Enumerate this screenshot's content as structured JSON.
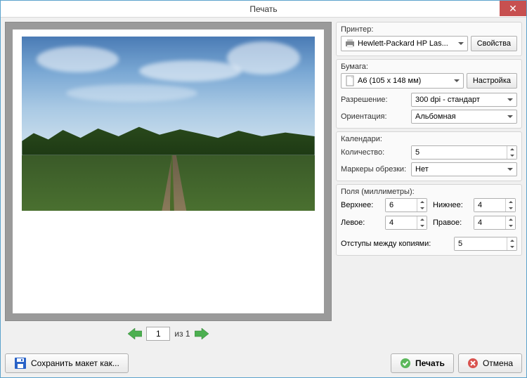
{
  "window_title": "Печать",
  "printer": {
    "section_label": "Принтер:",
    "selected": "Hewlett-Packard HP Las...",
    "props_btn": "Свойства"
  },
  "paper": {
    "section_label": "Бумага:",
    "selected": "A6 (105 x 148 мм)",
    "setup_btn": "Настройка",
    "resolution_label": "Разрешение:",
    "resolution_value": "300 dpi - стандарт",
    "orientation_label": "Ориентация:",
    "orientation_value": "Альбомная"
  },
  "calendars": {
    "section_label": "Календари:",
    "count_label": "Количество:",
    "count_value": "5",
    "crop_label": "Маркеры обрезки:",
    "crop_value": "Нет"
  },
  "margins": {
    "section_label": "Поля (миллиметры):",
    "top_label": "Верхнее:",
    "top_value": "6",
    "bottom_label": "Нижнее:",
    "bottom_value": "4",
    "left_label": "Левое:",
    "left_value": "4",
    "right_label": "Правое:",
    "right_value": "4",
    "gutter_label": "Отступы между копиями:",
    "gutter_value": "5"
  },
  "nav": {
    "page_value": "1",
    "page_total": "из 1"
  },
  "footer": {
    "save_layout": "Сохранить макет как...",
    "print": "Печать",
    "cancel": "Отмена"
  }
}
